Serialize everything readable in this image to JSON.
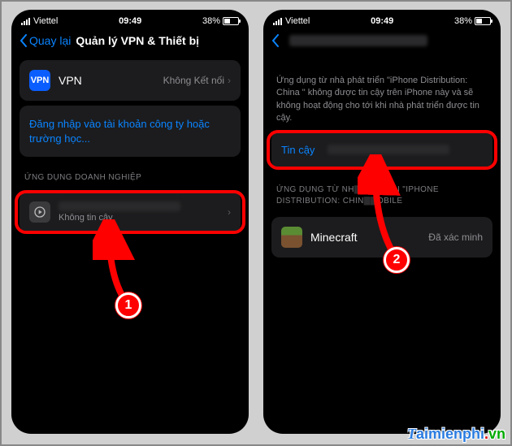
{
  "status": {
    "carrier": "Viettel",
    "time": "09:49",
    "battery": "38%"
  },
  "left": {
    "back": "Quay lại",
    "title": "Quản lý VPN & Thiết bị",
    "vpn_label": "VPN",
    "vpn_status": "Không Kết nối",
    "signin": "Đăng nhập vào tài khoản công ty hoặc trường học...",
    "enterprise_header": "ỨNG DỤNG DOANH NGHIỆP",
    "dev_sub": "Không tin cậy"
  },
  "right": {
    "desc": "Ứng dụng từ nhà phát triển \"iPhone Distribution: China                         \" không được tin cậy trên iPhone này và sẽ không hoạt động cho tới khi nhà phát triển được tin cậy.",
    "trust": "Tin cậy",
    "apps_header1": "ỨNG DỤNG TỪ NH",
    "apps_header2": "TRIỂN \"IPHONE",
    "apps_header3": "DISTRIBUTION: CHIN",
    "apps_header4": "OBILE",
    "app_name": "Minecraft",
    "app_status": "Đã xác minh"
  },
  "annot": {
    "num1": "1",
    "num2": "2"
  },
  "watermark": {
    "a": "aimienphi",
    "t": "T",
    "dot": ".",
    "tld": "vn"
  }
}
